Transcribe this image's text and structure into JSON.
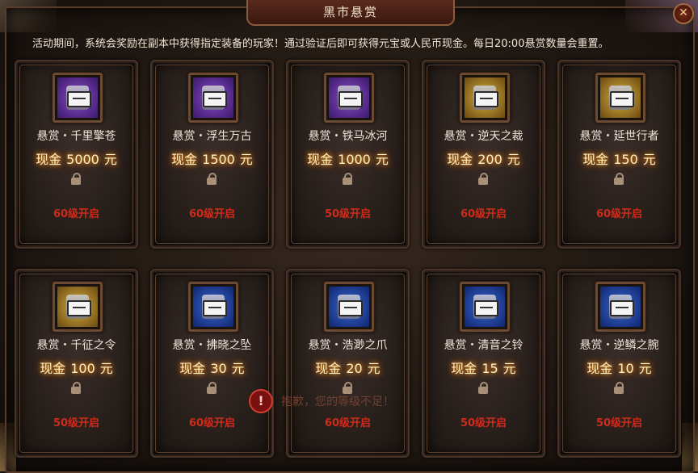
{
  "window": {
    "title": "黑市悬赏",
    "close_label": "✕"
  },
  "description": "活动期间，系统会奖励在副本中获得指定装备的玩家！通过验证后即可获得元宝或人民币现金。每日20:00悬赏数量会重置。",
  "reward_prefix": "现金",
  "reward_suffix": "元",
  "cards": [
    {
      "name": "悬赏・千里擎苍",
      "amount": "5000",
      "unlock": "60级开启",
      "rarity": "purple"
    },
    {
      "name": "悬赏・浮生万古",
      "amount": "1500",
      "unlock": "60级开启",
      "rarity": "purple"
    },
    {
      "name": "悬赏・铁马冰河",
      "amount": "1000",
      "unlock": "50级开启",
      "rarity": "purple"
    },
    {
      "name": "悬赏・逆天之裁",
      "amount": "200",
      "unlock": "60级开启",
      "rarity": "gold"
    },
    {
      "name": "悬赏・延世行者",
      "amount": "150",
      "unlock": "60级开启",
      "rarity": "gold"
    },
    {
      "name": "悬赏・千征之令",
      "amount": "100",
      "unlock": "50级开启",
      "rarity": "gold"
    },
    {
      "name": "悬赏・拂晓之坠",
      "amount": "30",
      "unlock": "60级开启",
      "rarity": "blue"
    },
    {
      "name": "悬赏・浩渺之爪",
      "amount": "20",
      "unlock": "60级开启",
      "rarity": "blue"
    },
    {
      "name": "悬赏・清音之铃",
      "amount": "15",
      "unlock": "50级开启",
      "rarity": "blue"
    },
    {
      "name": "悬赏・逆鳞之腕",
      "amount": "10",
      "unlock": "50级开启",
      "rarity": "blue"
    }
  ],
  "toast": {
    "icon": "!",
    "text": "抱歉，您的等级不足！"
  }
}
